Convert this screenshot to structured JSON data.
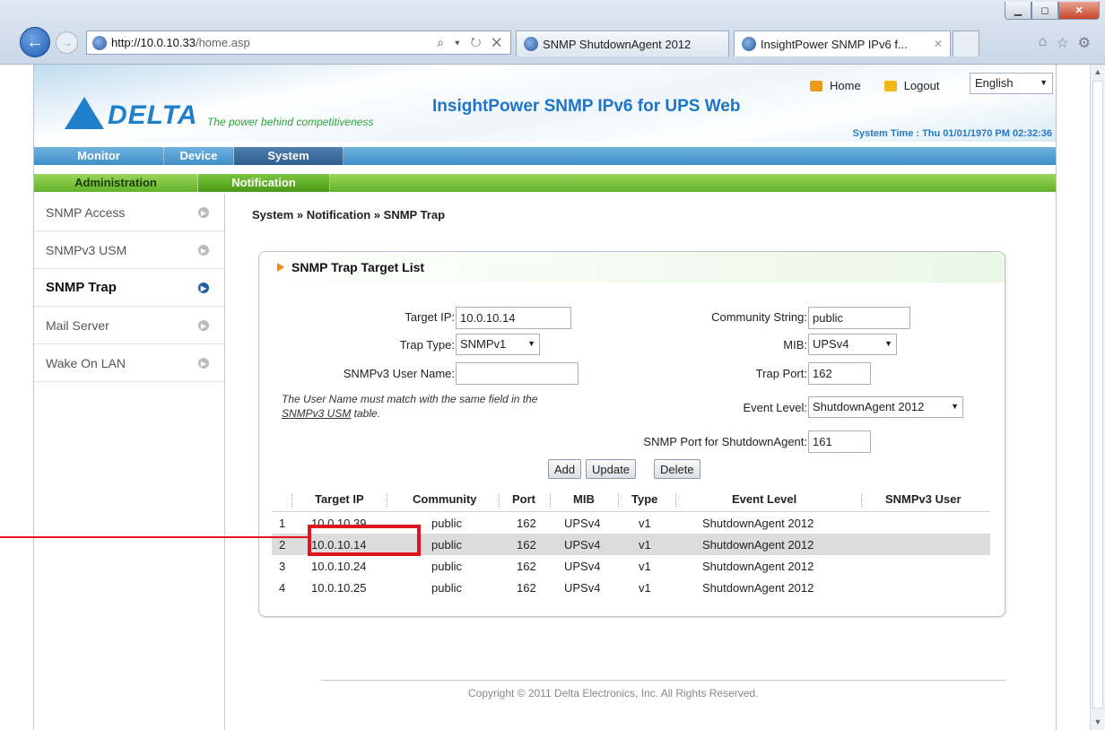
{
  "browser": {
    "window_buttons": [
      "▁",
      "◻",
      "✕"
    ],
    "address": {
      "host": "http://10.0.10.33",
      "path": "/home.asp",
      "tools": "⌕ ▾ ↻ ✕"
    },
    "tabs": [
      {
        "label": "SNMP ShutdownAgent 2012"
      },
      {
        "label": "InsightPower SNMP IPv6 f...",
        "close": "✕"
      }
    ],
    "toolbar_icons": [
      "⌂",
      "☆",
      "⚙"
    ]
  },
  "header": {
    "logo_text": "DELTA",
    "tagline": "The power behind competitiveness",
    "title": "InsightPower SNMP IPv6 for UPS Web",
    "home_label": "Home",
    "logout_label": "Logout",
    "language": "English",
    "system_time": "System Time : Thu 01/01/1970 PM 02:32:36"
  },
  "nav_main": [
    "Monitor",
    "Device",
    "System"
  ],
  "nav_sub": [
    "Administration",
    "Notification"
  ],
  "sidebar": {
    "items": [
      {
        "label": "SNMP Access"
      },
      {
        "label": "SNMPv3 USM"
      },
      {
        "label": "SNMP Trap"
      },
      {
        "label": "Mail Server"
      },
      {
        "label": "Wake On LAN"
      }
    ]
  },
  "breadcrumb": "System » Notification » SNMP Trap",
  "panel": {
    "title": "SNMP Trap Target List",
    "form": {
      "target_ip_label": "Target IP:",
      "target_ip": "10.0.10.14",
      "trap_type_label": "Trap Type:",
      "trap_type": "SNMPv1",
      "v3_user_label": "SNMPv3 User Name:",
      "v3_user": "",
      "note_line1": "The User Name must match with the same field in the",
      "note_link": "SNMPv3 USM",
      "note_tail": " table.",
      "community_label": "Community String:",
      "community": "public",
      "mib_label": "MIB:",
      "mib": "UPSv4",
      "trap_port_label": "Trap Port:",
      "trap_port": "162",
      "event_level_label": "Event Level:",
      "event_level": "ShutdownAgent 2012",
      "sa_port_label": "SNMP Port for ShutdownAgent:",
      "sa_port": "161"
    },
    "buttons": {
      "add": "Add",
      "update": "Update",
      "delete": "Delete"
    },
    "table": {
      "headers": [
        "Target IP",
        "Community",
        "Port",
        "MIB",
        "Type",
        "Event Level",
        "SNMPv3 User"
      ],
      "rows": [
        {
          "n": "1",
          "ip": "10.0.10.39",
          "community": "public",
          "port": "162",
          "mib": "UPSv4",
          "type": "v1",
          "event": "ShutdownAgent 2012",
          "user": ""
        },
        {
          "n": "2",
          "ip": "10.0.10.14",
          "community": "public",
          "port": "162",
          "mib": "UPSv4",
          "type": "v1",
          "event": "ShutdownAgent 2012",
          "user": ""
        },
        {
          "n": "3",
          "ip": "10.0.10.24",
          "community": "public",
          "port": "162",
          "mib": "UPSv4",
          "type": "v1",
          "event": "ShutdownAgent 2012",
          "user": ""
        },
        {
          "n": "4",
          "ip": "10.0.10.25",
          "community": "public",
          "port": "162",
          "mib": "UPSv4",
          "type": "v1",
          "event": "ShutdownAgent 2012",
          "user": ""
        }
      ]
    }
  },
  "footer": "Copyright © 2011 Delta Electronics, Inc. All Rights Reserved.",
  "colors": {
    "accent_blue": "#1e74c8",
    "nav_blue": "#3f8fc8",
    "nav_green": "#62b22a",
    "highlight_red": "#e0151b"
  }
}
